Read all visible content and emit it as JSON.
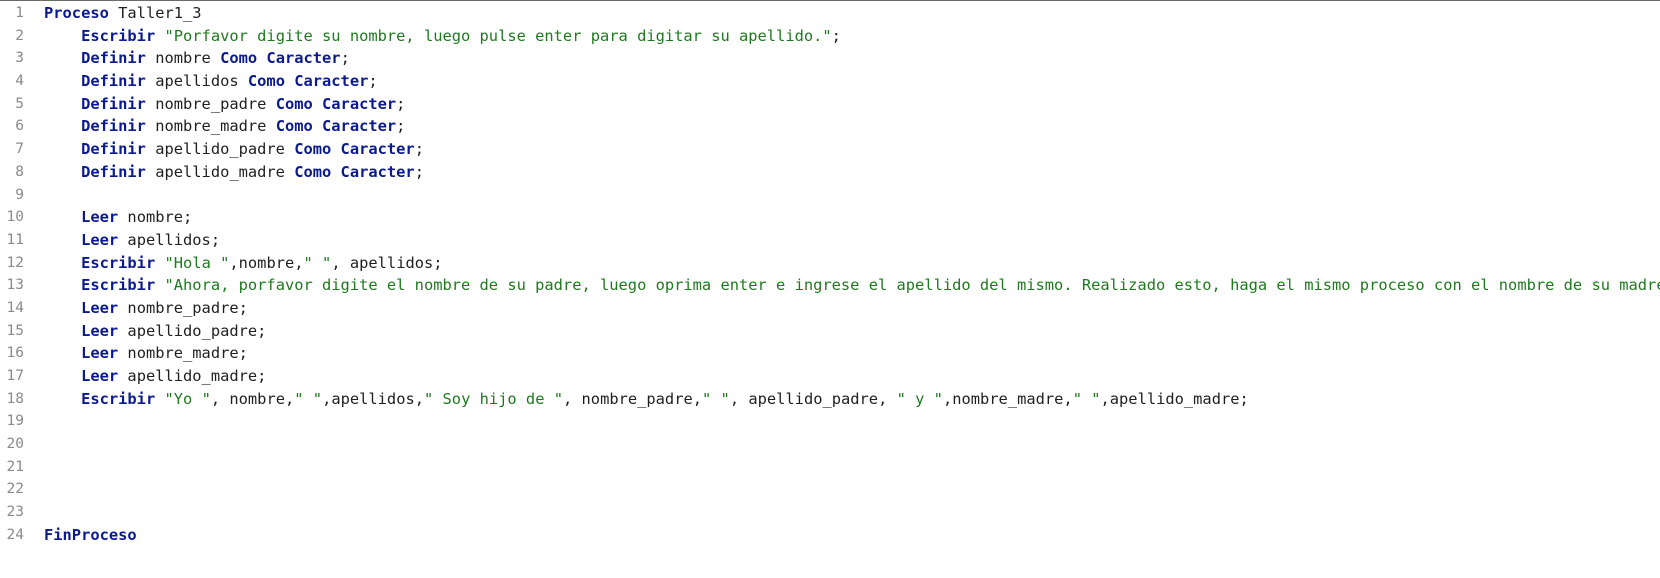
{
  "colors": {
    "keyword": "#0b1a8f",
    "string": "#1f7a1f",
    "text": "#1f1f1f",
    "line_number": "#8a8a8a",
    "background": "#ffffff"
  },
  "editor": {
    "lines": [
      {
        "number": "1",
        "indent": "",
        "tokens": [
          {
            "t": "kw",
            "v": "Proceso"
          },
          {
            "t": "id",
            "v": " Taller1_3"
          }
        ]
      },
      {
        "number": "2",
        "indent": "    ",
        "tokens": [
          {
            "t": "kw",
            "v": "Escribir"
          },
          {
            "t": "id",
            "v": " "
          },
          {
            "t": "str",
            "v": "\"Porfavor digite su nombre, luego pulse enter para digitar su apellido.\""
          },
          {
            "t": "punc",
            "v": ";"
          }
        ]
      },
      {
        "number": "3",
        "indent": "    ",
        "tokens": [
          {
            "t": "kw",
            "v": "Definir"
          },
          {
            "t": "id",
            "v": " nombre "
          },
          {
            "t": "kw",
            "v": "Como Caracter"
          },
          {
            "t": "punc",
            "v": ";"
          }
        ]
      },
      {
        "number": "4",
        "indent": "    ",
        "tokens": [
          {
            "t": "kw",
            "v": "Definir"
          },
          {
            "t": "id",
            "v": " apellidos "
          },
          {
            "t": "kw",
            "v": "Como Caracter"
          },
          {
            "t": "punc",
            "v": ";"
          }
        ]
      },
      {
        "number": "5",
        "indent": "    ",
        "tokens": [
          {
            "t": "kw",
            "v": "Definir"
          },
          {
            "t": "id",
            "v": " nombre_padre "
          },
          {
            "t": "kw",
            "v": "Como Caracter"
          },
          {
            "t": "punc",
            "v": ";"
          }
        ]
      },
      {
        "number": "6",
        "indent": "    ",
        "tokens": [
          {
            "t": "kw",
            "v": "Definir"
          },
          {
            "t": "id",
            "v": " nombre_madre "
          },
          {
            "t": "kw",
            "v": "Como Caracter"
          },
          {
            "t": "punc",
            "v": ";"
          }
        ]
      },
      {
        "number": "7",
        "indent": "    ",
        "tokens": [
          {
            "t": "kw",
            "v": "Definir"
          },
          {
            "t": "id",
            "v": " apellido_padre "
          },
          {
            "t": "kw",
            "v": "Como Caracter"
          },
          {
            "t": "punc",
            "v": ";"
          }
        ]
      },
      {
        "number": "8",
        "indent": "    ",
        "tokens": [
          {
            "t": "kw",
            "v": "Definir"
          },
          {
            "t": "id",
            "v": " apellido_madre "
          },
          {
            "t": "kw",
            "v": "Como Caracter"
          },
          {
            "t": "punc",
            "v": ";"
          }
        ]
      },
      {
        "number": "9",
        "indent": "",
        "tokens": []
      },
      {
        "number": "10",
        "indent": "    ",
        "tokens": [
          {
            "t": "kw",
            "v": "Leer"
          },
          {
            "t": "id",
            "v": " nombre"
          },
          {
            "t": "punc",
            "v": ";"
          }
        ]
      },
      {
        "number": "11",
        "indent": "    ",
        "tokens": [
          {
            "t": "kw",
            "v": "Leer"
          },
          {
            "t": "id",
            "v": " apellidos"
          },
          {
            "t": "punc",
            "v": ";"
          }
        ]
      },
      {
        "number": "12",
        "indent": "    ",
        "tokens": [
          {
            "t": "kw",
            "v": "Escribir"
          },
          {
            "t": "id",
            "v": " "
          },
          {
            "t": "str",
            "v": "\"Hola \""
          },
          {
            "t": "id",
            "v": ",nombre,"
          },
          {
            "t": "str",
            "v": "\" \""
          },
          {
            "t": "id",
            "v": ", apellidos"
          },
          {
            "t": "punc",
            "v": ";"
          }
        ]
      },
      {
        "number": "13",
        "indent": "    ",
        "tokens": [
          {
            "t": "kw",
            "v": "Escribir"
          },
          {
            "t": "id",
            "v": " "
          },
          {
            "t": "str",
            "v": "\"Ahora, porfavor digite el nombre de su padre, luego oprima enter e ingrese el apellido del mismo. Realizado esto, haga el mismo proceso con el nombre de su madre.\""
          },
          {
            "t": "punc",
            "v": ";"
          }
        ]
      },
      {
        "number": "14",
        "indent": "    ",
        "tokens": [
          {
            "t": "kw",
            "v": "Leer"
          },
          {
            "t": "id",
            "v": " nombre_padre"
          },
          {
            "t": "punc",
            "v": ";"
          }
        ]
      },
      {
        "number": "15",
        "indent": "    ",
        "tokens": [
          {
            "t": "kw",
            "v": "Leer"
          },
          {
            "t": "id",
            "v": " apellido_padre"
          },
          {
            "t": "punc",
            "v": ";"
          }
        ]
      },
      {
        "number": "16",
        "indent": "    ",
        "tokens": [
          {
            "t": "kw",
            "v": "Leer"
          },
          {
            "t": "id",
            "v": " nombre_madre"
          },
          {
            "t": "punc",
            "v": ";"
          }
        ]
      },
      {
        "number": "17",
        "indent": "    ",
        "tokens": [
          {
            "t": "kw",
            "v": "Leer"
          },
          {
            "t": "id",
            "v": " apellido_madre"
          },
          {
            "t": "punc",
            "v": ";"
          }
        ]
      },
      {
        "number": "18",
        "indent": "    ",
        "tokens": [
          {
            "t": "kw",
            "v": "Escribir"
          },
          {
            "t": "id",
            "v": " "
          },
          {
            "t": "str",
            "v": "\"Yo \""
          },
          {
            "t": "id",
            "v": ", nombre,"
          },
          {
            "t": "str",
            "v": "\" \""
          },
          {
            "t": "id",
            "v": ",apellidos,"
          },
          {
            "t": "str",
            "v": "\" Soy hijo de \""
          },
          {
            "t": "id",
            "v": ", nombre_padre,"
          },
          {
            "t": "str",
            "v": "\" \""
          },
          {
            "t": "id",
            "v": ", apellido_padre, "
          },
          {
            "t": "str",
            "v": "\" y \""
          },
          {
            "t": "id",
            "v": ",nombre_madre,"
          },
          {
            "t": "str",
            "v": "\" \""
          },
          {
            "t": "id",
            "v": ",apellido_madre"
          },
          {
            "t": "punc",
            "v": ";"
          }
        ]
      },
      {
        "number": "19",
        "indent": "",
        "tokens": []
      },
      {
        "number": "20",
        "indent": "",
        "tokens": []
      },
      {
        "number": "21",
        "indent": "",
        "tokens": []
      },
      {
        "number": "22",
        "indent": "",
        "tokens": []
      },
      {
        "number": "23",
        "indent": "",
        "tokens": []
      },
      {
        "number": "24",
        "indent": "",
        "tokens": [
          {
            "t": "kw",
            "v": "FinProceso"
          }
        ]
      }
    ]
  }
}
